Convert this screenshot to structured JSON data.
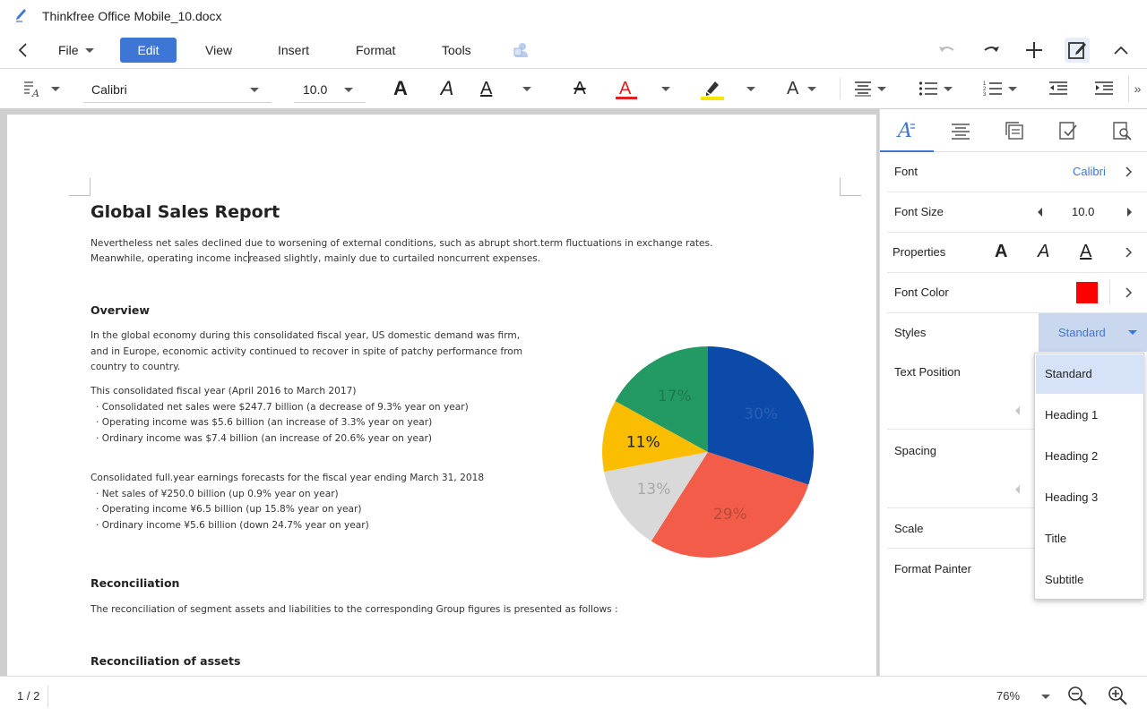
{
  "window": {
    "title": "Thinkfree Office Mobile_10.docx",
    "app_icon": "pen-icon"
  },
  "menubar": {
    "back_icon": "back-arrow-icon",
    "items": [
      {
        "label": "File",
        "has_dropdown": true
      },
      {
        "label": "Edit",
        "active": true
      },
      {
        "label": "View"
      },
      {
        "label": "Insert"
      },
      {
        "label": "Format"
      },
      {
        "label": "Tools"
      }
    ],
    "right_icons": [
      "undo-icon",
      "redo-icon",
      "add-icon",
      "edit-mode-icon",
      "collapse-up-icon"
    ]
  },
  "toolbar": {
    "font_name": "Calibri",
    "font_size": "10.0",
    "buttons": [
      "style-icon",
      "bold-icon",
      "italic-icon",
      "underline-icon",
      "strikethrough-icon",
      "font-color-icon",
      "highlight-icon",
      "text-effect-icon",
      "align-icon",
      "bullet-list-icon",
      "numbered-list-icon",
      "decrease-indent-icon",
      "increase-indent-icon",
      "more-icon"
    ],
    "font_color": "#e02020",
    "highlight_color": "#f7e600"
  },
  "document": {
    "title": "Global Sales Report",
    "intro_line1": "Nevertheless net sales declined due to worsening of external conditions, such as abrupt short.term fluctuations in exchange rates.",
    "intro_line2a": "Meanwhile, operating income inc",
    "intro_line2b": "reased slightly, mainly due to curtailed noncurrent expenses.",
    "overview_heading": "Overview",
    "overview_p1": [
      "In the global economy during this consolidated fiscal year, US domestic demand was firm,",
      "and in Europe, economic activity continued to recover in spite of patchy performance from",
      "country to country."
    ],
    "overview_p2": [
      "This consolidated fiscal year (April 2016 to March 2017)",
      "· Consolidated net sales were $247.7 billion (a decrease of 9.3% year on year)",
      "· Operating income was $5.6 billion (an increase of 3.3% year on year)",
      "· Ordinary income was $7.4 billion (an increase of 20.6% year on year)"
    ],
    "overview_p3": [
      "Consolidated full.year earnings forecasts for the fiscal year ending March 31, 2018",
      "· Net sales of ¥250.0 billion (up 0.9% year on year)",
      "· Operating income ¥6.5 billion (up 15.8% year on year)",
      "· Ordinary income ¥5.6 billion (down 24.7% year on year)"
    ],
    "reconciliation_heading": "Reconciliation",
    "reconciliation_text": "The reconciliation of segment assets and liabilities to the corresponding Group figures is presented as follows :",
    "reconciliation_assets_heading": "Reconciliation of assets"
  },
  "chart_data": {
    "type": "pie",
    "slices": [
      {
        "label": "30%",
        "value": 30,
        "color": "#0b4aa8",
        "label_color": "#2a5fb8"
      },
      {
        "label": "29%",
        "value": 29,
        "color": "#f25c49",
        "label_color": "#b84a3c"
      },
      {
        "label": "13%",
        "value": 13,
        "color": "#d9d9d9",
        "label_color": "#a8a8a8"
      },
      {
        "label": "11%",
        "value": 11,
        "color": "#fbbd00",
        "label_color": "#222222"
      },
      {
        "label": "17%",
        "value": 17,
        "color": "#239a63",
        "label_color": "#1c7a4e"
      }
    ],
    "start": "12 o'clock, clockwise"
  },
  "panel": {
    "tabs": [
      "font-format-icon",
      "paragraph-align-icon",
      "layout-icon",
      "review-icon",
      "find-icon"
    ],
    "font": {
      "label": "Font",
      "value": "Calibri"
    },
    "font_size": {
      "label": "Font Size",
      "value": "10.0"
    },
    "properties": {
      "label": "Properties"
    },
    "font_color": {
      "label": "Font Color",
      "swatch": "#ff0000"
    },
    "styles": {
      "label": "Styles",
      "value": "Standard"
    },
    "text_position": {
      "label": "Text Position"
    },
    "spacing": {
      "label": "Spacing"
    },
    "scale": {
      "label": "Scale"
    },
    "format_painter": {
      "label": "Format Painter"
    },
    "styles_options": [
      "Standard",
      "Heading 1",
      "Heading 2",
      "Heading 3",
      "Title",
      "Subtitle"
    ]
  },
  "statusbar": {
    "page": "1 / 2",
    "zoom": "76%"
  },
  "colors": {
    "accent": "#3e76d6",
    "selection": "#c9d7ef"
  }
}
